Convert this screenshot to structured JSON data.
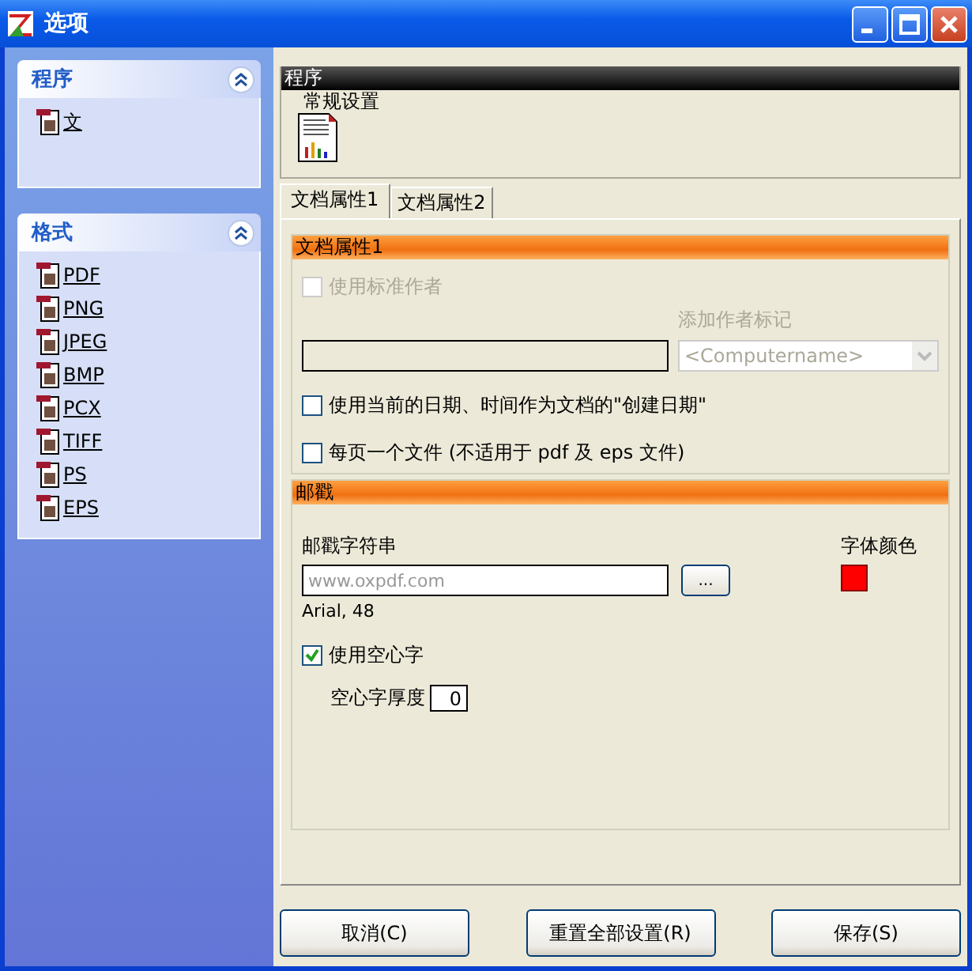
{
  "window": {
    "title": "选项"
  },
  "sidebar": [
    {
      "title": "程序",
      "expanded": true,
      "items": [
        {
          "label": "文"
        }
      ]
    },
    {
      "title": "格式",
      "expanded": true,
      "items": [
        {
          "label": "PDF"
        },
        {
          "label": "PNG"
        },
        {
          "label": "JPEG"
        },
        {
          "label": "BMP"
        },
        {
          "label": "PCX"
        },
        {
          "label": "TIFF"
        },
        {
          "label": "PS"
        },
        {
          "label": "EPS"
        }
      ]
    }
  ],
  "section": {
    "title": "程序",
    "item": "常规设置"
  },
  "tabs": [
    {
      "label": "文档属性1",
      "selected": true
    },
    {
      "label": "文档属性2",
      "selected": false
    }
  ],
  "doc_group": {
    "title": "文档属性1",
    "use_standard_author": {
      "label": "使用标准作者",
      "checked": false,
      "disabled": true
    },
    "author_tag": {
      "label": "添加作者标记",
      "placeholder": "<Computername>",
      "disabled": true
    },
    "use_date": {
      "label": "使用当前的日期、时间作为文档的\"创建日期\"",
      "checked": false
    },
    "one_file_per_page": {
      "label": "每页一个文件 (不适用于 pdf 及 eps 文件)",
      "checked": false
    }
  },
  "stamp_group": {
    "title": "邮戳",
    "string_label": "邮戳字符串",
    "string_placeholder": "www.oxpdf.com",
    "browse_button": "...",
    "font": "Arial, 48",
    "color_label": "字体颜色",
    "outline": {
      "label": "使用空心字",
      "checked": true
    },
    "thickness": {
      "label": "空心字厚度",
      "value": "0"
    }
  },
  "buttons": [
    "取消(C)",
    "重置全部设置(R)",
    "保存(S)"
  ]
}
